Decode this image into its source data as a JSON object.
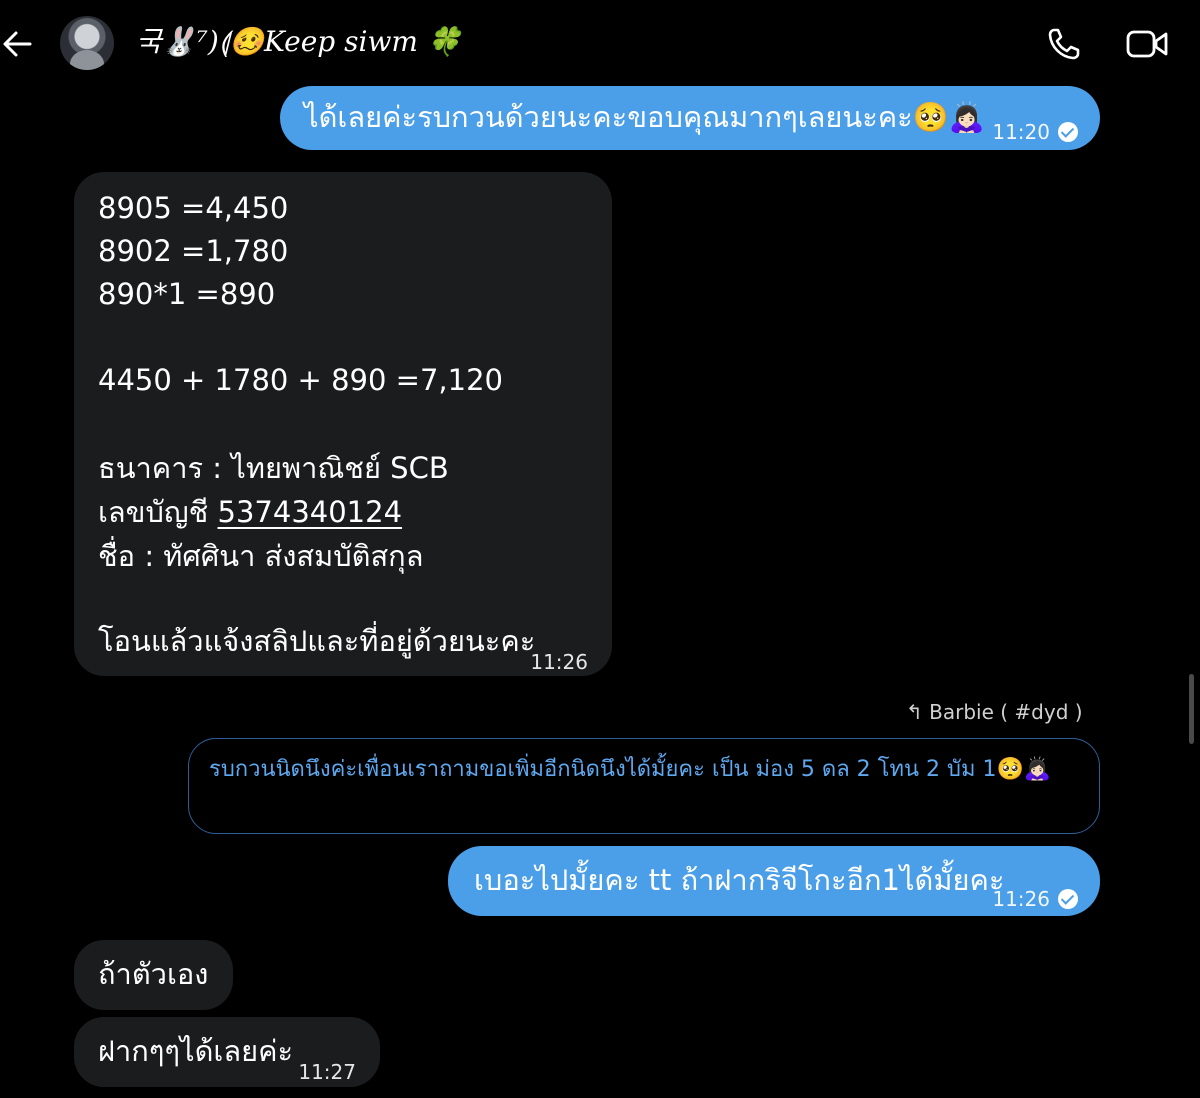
{
  "header": {
    "back_icon": "arrow-left-icon",
    "contact_name": "국🐰⁷)⟬🥴Keep siwm 🍀",
    "call_icon": "phone-icon",
    "video_icon": "video-camera-icon"
  },
  "messages": [
    {
      "direction": "outgoing",
      "text": "ได้เลยค่ะรบกวนด้วยนะคะขอบคุณมากๆเลยนะคะ🥺🙇🏻‍♀️",
      "time": "11:20",
      "read": true
    },
    {
      "direction": "incoming",
      "lines": [
        "8905 =4,450",
        "8902 =1,780",
        "890*1 =890",
        "4450 + 1780 + 890 =7,120",
        "ธนาคาร : ไทยพาณิชย์ SCB",
        "เลขบัญชี ",
        "5374340124",
        "ชื่อ : ทัศศินา ส่งสมบัติสกุล",
        "โอนแล้วแจ้งสลิปและที่อยู่ด้วยนะคะ"
      ],
      "time": "11:26"
    },
    {
      "direction": "outgoing",
      "reply_to_icon": "reply-arrow-icon",
      "reply_to": "Barbie ( #dyd )",
      "quoted_text": "รบกวนนิดนึงค่ะเพื่อนเราถามขอเพิ่มอีกนิดนึงได้มั้ยคะ เป็น ม่อง 5 ดล 2 โทน 2 บัม 1🥺🙇🏻‍♀️"
    },
    {
      "direction": "outgoing",
      "text": "เบอะไปมั้ยคะ tt ถ้าฝากริจีโกะอีก1ได้มั้ยคะ",
      "time": "11:26",
      "read": true
    },
    {
      "direction": "incoming",
      "text": "ถ้าตัวเอง"
    },
    {
      "direction": "incoming",
      "text": "ฝากๆๆได้เลยค่ะ",
      "time": "11:27"
    }
  ],
  "colors": {
    "background": "#000000",
    "outgoing_bubble": "#4b9ee8",
    "incoming_bubble": "#1b1c1e",
    "quote_text": "#5ea8f0",
    "quote_border": "#2f5f9a"
  }
}
